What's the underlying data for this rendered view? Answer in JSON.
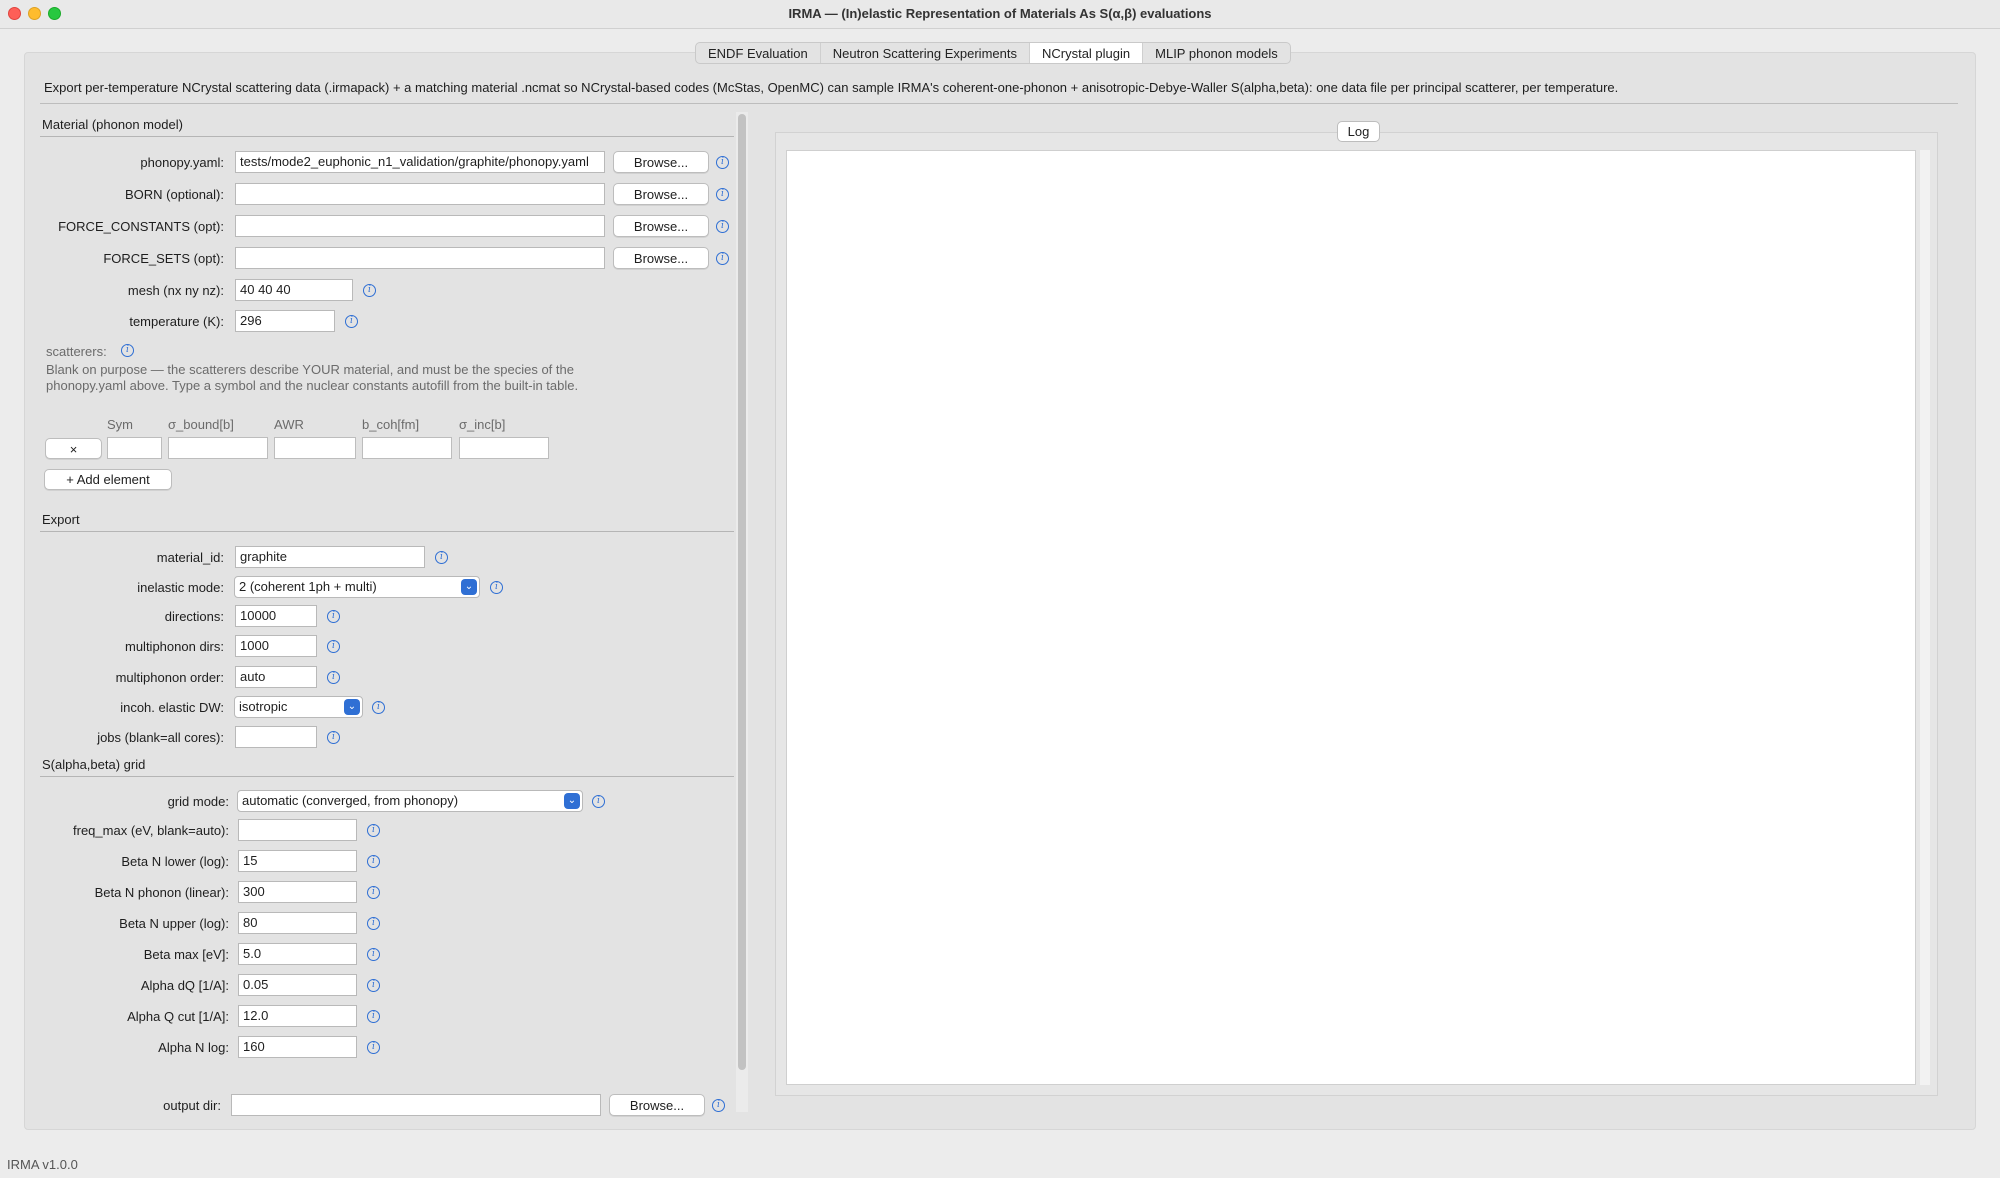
{
  "window": {
    "title": "IRMA — (In)elastic Representation of Materials As S(α,β) evaluations"
  },
  "tabs": [
    {
      "label": "ENDF Evaluation",
      "active": false
    },
    {
      "label": "Neutron Scattering Experiments",
      "active": false
    },
    {
      "label": "NCrystal plugin",
      "active": true
    },
    {
      "label": "MLIP phonon models",
      "active": false
    }
  ],
  "description": "Export per-temperature NCrystal scattering data (.irmapack) + a matching material .ncmat so NCrystal-based codes (McStas, OpenMC) can sample IRMA's coherent-one-phonon + anisotropic-Debye-Waller S(alpha,beta): one data file per principal scatterer, per temperature.",
  "material": {
    "section_title": "Material (phonon model)",
    "phonopy": {
      "label": "phonopy.yaml:",
      "value": "tests/mode2_euphonic_n1_validation/graphite/phonopy.yaml",
      "browse": "Browse..."
    },
    "born": {
      "label": "BORN (optional):",
      "value": "",
      "browse": "Browse..."
    },
    "force_constants": {
      "label": "FORCE_CONSTANTS (opt):",
      "value": "",
      "browse": "Browse..."
    },
    "force_sets": {
      "label": "FORCE_SETS (opt):",
      "value": "",
      "browse": "Browse..."
    },
    "mesh": {
      "label": "mesh (nx ny nz):",
      "value": "40 40 40"
    },
    "temperature": {
      "label": "temperature (K):",
      "value": "296"
    },
    "scatterers": {
      "label": "scatterers:",
      "hint": "Blank on purpose — the scatterers describe YOUR material, and must be the species of the phonopy.yaml above. Type a symbol and the nuclear constants autofill from the built-in table.",
      "columns": [
        "Sym",
        "σ_bound[b]",
        "AWR",
        "b_coh[fm]",
        "σ_inc[b]"
      ],
      "remove_label": "×",
      "add_label": "+ Add element"
    }
  },
  "export": {
    "section_title": "Export",
    "material_id": {
      "label": "material_id:",
      "value": "graphite"
    },
    "inelastic_mode": {
      "label": "inelastic mode:",
      "value": "2 (coherent 1ph + multi)"
    },
    "directions": {
      "label": "directions:",
      "value": "10000"
    },
    "multiphonon_dirs": {
      "label": "multiphonon dirs:",
      "value": "1000"
    },
    "multiphonon_order": {
      "label": "multiphonon order:",
      "value": "auto"
    },
    "incoh_elastic_dw": {
      "label": "incoh. elastic DW:",
      "value": "isotropic"
    },
    "jobs": {
      "label": "jobs (blank=all cores):",
      "value": ""
    }
  },
  "grid": {
    "section_title": "S(alpha,beta) grid",
    "grid_mode": {
      "label": "grid mode:",
      "value": "automatic (converged, from phonopy)"
    },
    "freq_max": {
      "label": "freq_max (eV, blank=auto):",
      "value": ""
    },
    "beta_n_lower": {
      "label": "Beta N lower (log):",
      "value": "15"
    },
    "beta_n_phonon": {
      "label": "Beta N phonon (linear):",
      "value": "300"
    },
    "beta_n_upper": {
      "label": "Beta N upper (log):",
      "value": "80"
    },
    "beta_max": {
      "label": "Beta max [eV]:",
      "value": "5.0"
    },
    "alpha_dq": {
      "label": "Alpha dQ [1/A]:",
      "value": "0.05"
    },
    "alpha_q_cut": {
      "label": "Alpha Q cut [1/A]:",
      "value": "12.0"
    },
    "alpha_n_log": {
      "label": "Alpha N log:",
      "value": "160"
    }
  },
  "output": {
    "label": "output dir:",
    "value": "",
    "browse": "Browse..."
  },
  "log": {
    "label": "Log"
  },
  "footer": "IRMA v1.0.0",
  "colors": {
    "accent": "#2f6fd4",
    "close": "#fe5f57",
    "minimize": "#febc2e",
    "maximize": "#28c840"
  }
}
